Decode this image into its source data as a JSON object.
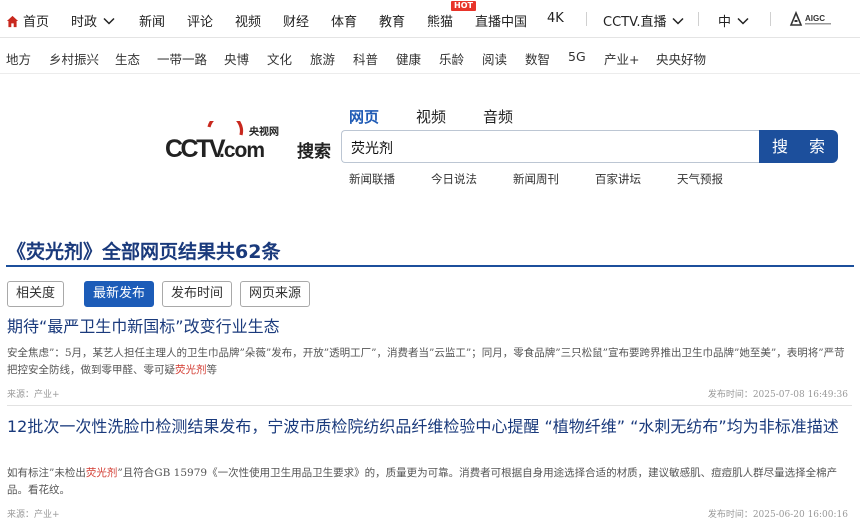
{
  "topnav": {
    "home": "首页",
    "current_affairs": "时政",
    "news": "新闻",
    "commentary": "评论",
    "video": "视频",
    "finance": "财经",
    "sports": "体育",
    "education": "教育",
    "panda": "熊猫",
    "hot_badge": "HOT",
    "live_china": "直播中国",
    "fourk": "4K",
    "cctv_live": "CCTV.直播",
    "language": "中",
    "aigc": "AIGC"
  },
  "subnav": [
    "地方",
    "乡村振兴",
    "生态",
    "一带一路",
    "央博",
    "文化",
    "旅游",
    "科普",
    "健康",
    "乐龄",
    "阅读",
    "数智",
    "5G",
    "产业+",
    "央央好物"
  ],
  "logo": {
    "cctv": "CCTV",
    "com": ".com",
    "cn_name": "央视网",
    "search_word": "搜索"
  },
  "search": {
    "tabs": [
      "网页",
      "视频",
      "音频"
    ],
    "query": "荧光剂",
    "button": "搜 索",
    "quick_links": [
      "新闻联播",
      "今日说法",
      "新闻周刊",
      "百家讲坛",
      "天气预报"
    ]
  },
  "results_header": "《荧光剂》全部网页结果共62条",
  "sort_options": [
    "相关度",
    "最新发布",
    "发布时间",
    "网页来源"
  ],
  "results": [
    {
      "title": "期待“最严卫生巾新国标”改变行业生态",
      "snippet_before": "安全焦虑”：5月，某艺人担任主理人的卫生巾品牌”朵薇”发布，开放”透明工厂”，消费者当”云监工”；同月，零食品牌”三只松鼠”宣布要跨界推出卫生巾品牌”她至美”，表明将”严苛把控安全防线，做到零甲醛、零可疑",
      "snippet_hl": "荧光剂",
      "snippet_after": "等",
      "source": "来源：产业+",
      "time": "发布时间：2025-07-08 16:49:36"
    },
    {
      "title": "12批次一次性洗脸巾检测结果发布，宁波市质检院纺织品纤维检验中心提醒 “植物纤维” “水刺无纺布”均为非标准描述",
      "snippet_before": "如有标注”未检出",
      "snippet_hl": "荧光剂",
      "snippet_after": "”且符合GB 15979《一次性使用卫生用品卫生要求》的，质量更为可靠。消费者可根据自身用途选择合适的材质，建议敏感肌、痘痘肌人群尽量选择全棉产品。看花纹。",
      "source": "来源：产业+",
      "time": "发布时间：2025-06-20 16:00:16"
    }
  ],
  "colors": {
    "brand_blue": "#1c4f9c",
    "title_blue": "#1a3a7c",
    "highlight_red": "#d23a30",
    "hot_red": "#e8342a"
  }
}
